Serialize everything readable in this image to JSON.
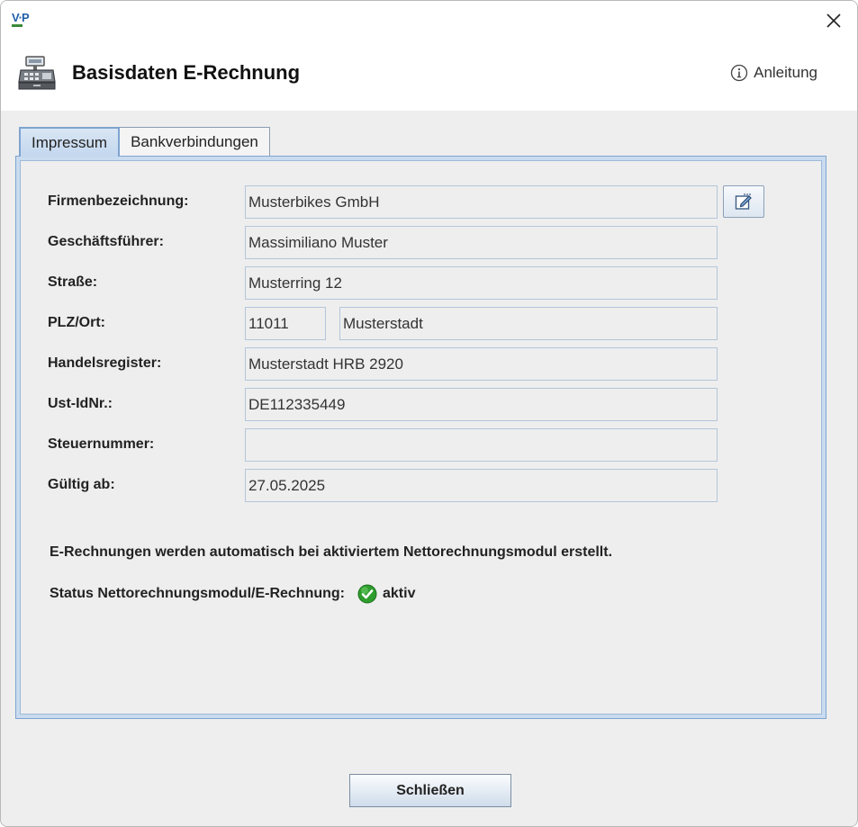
{
  "app": {
    "logo_text": "V·P"
  },
  "header": {
    "title": "Basisdaten E-Rechnung",
    "help_label": "Anleitung"
  },
  "tabs": [
    {
      "label": "Impressum",
      "active": true
    },
    {
      "label": "Bankverbindungen",
      "active": false
    }
  ],
  "form": {
    "company": {
      "label": "Firmenbezeichnung:",
      "value": "Musterbikes GmbH"
    },
    "manager": {
      "label": "Geschäftsführer:",
      "value": "Massimiliano Muster"
    },
    "street": {
      "label": "Straße:",
      "value": "Musterring 12"
    },
    "zip_city": {
      "label": "PLZ/Ort:",
      "zip": "11011",
      "city": "Musterstadt"
    },
    "register": {
      "label": "Handelsregister:",
      "value": "Musterstadt HRB 2920"
    },
    "vat_id": {
      "label": "Ust-IdNr.:",
      "value": "DE112335449"
    },
    "tax_number": {
      "label": "Steuernummer:",
      "value": ""
    },
    "valid_from": {
      "label": "Gültig ab:",
      "value": "27.05.2025"
    }
  },
  "info_text": "E-Rechnungen werden automatisch bei aktiviertem Nettorechnungsmodul erstellt.",
  "status": {
    "label": "Status Nettorechnungsmodul/E-Rechnung:",
    "value": "aktiv",
    "icon": "check-circle-icon",
    "color": "#2e9d2e"
  },
  "footer": {
    "close_label": "Schließen"
  },
  "colors": {
    "accent": "#7ea4cf",
    "field_border": "#b4c6da"
  }
}
